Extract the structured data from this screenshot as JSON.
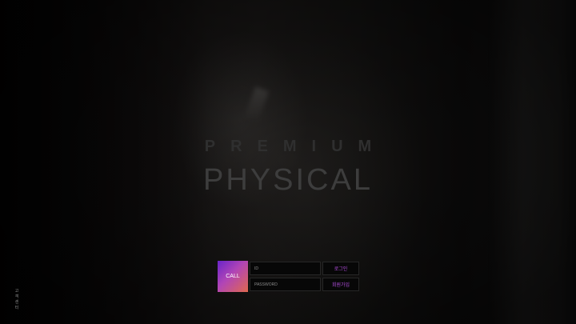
{
  "brand": {
    "tagline": "PREMIUM",
    "name": "PHYSICAL"
  },
  "login": {
    "call_label": "CALL",
    "id_placeholder": "ID",
    "password_placeholder": "PASSWORD",
    "login_button": "로그인",
    "join_button": "회원가입"
  },
  "side": {
    "chars": [
      "고",
      "객",
      "센",
      "터"
    ]
  },
  "colors": {
    "accent": "#b44fe0",
    "call_gradient_start": "#6a24c9",
    "call_gradient_end": "#e0684f",
    "background": "#070707"
  }
}
